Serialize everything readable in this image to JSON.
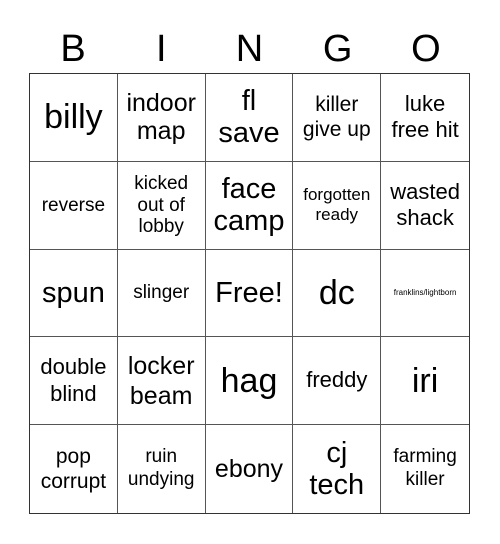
{
  "header": {
    "letters": [
      "B",
      "I",
      "N",
      "G",
      "O"
    ]
  },
  "cells": [
    "billy",
    "indoor map",
    "fl save",
    "killer give up",
    "luke free hit",
    "reverse",
    "kicked out of lobby",
    "face camp",
    "forgotten ready",
    "wasted shack",
    "spun",
    "slinger",
    "Free!",
    "dc",
    "franklins/lightborn",
    "double blind",
    "locker beam",
    "hag",
    "freddy",
    "iri",
    "pop corrupt",
    "ruin undying",
    "ebony",
    "cj tech",
    "farming killer"
  ],
  "display_lines": {
    "c1": [
      "indoor",
      "map"
    ],
    "c2": [
      "fl",
      "save"
    ],
    "c3": [
      "killer",
      "give up"
    ],
    "c4": [
      "luke",
      "free hit"
    ],
    "c6": [
      "kicked",
      "out of",
      "lobby"
    ],
    "c7": [
      "face",
      "camp"
    ],
    "c8": [
      "forgotten",
      "ready"
    ],
    "c9": [
      "wasted",
      "shack"
    ],
    "c15": [
      "double",
      "blind"
    ],
    "c16": [
      "locker",
      "beam"
    ],
    "c20": [
      "pop",
      "corrupt"
    ],
    "c21": [
      "ruin",
      "undying"
    ],
    "c23": [
      "cj",
      "tech"
    ],
    "c24": [
      "farming",
      "killer"
    ]
  },
  "free_space": {
    "row": 2,
    "col": 2,
    "label": "Free!"
  }
}
